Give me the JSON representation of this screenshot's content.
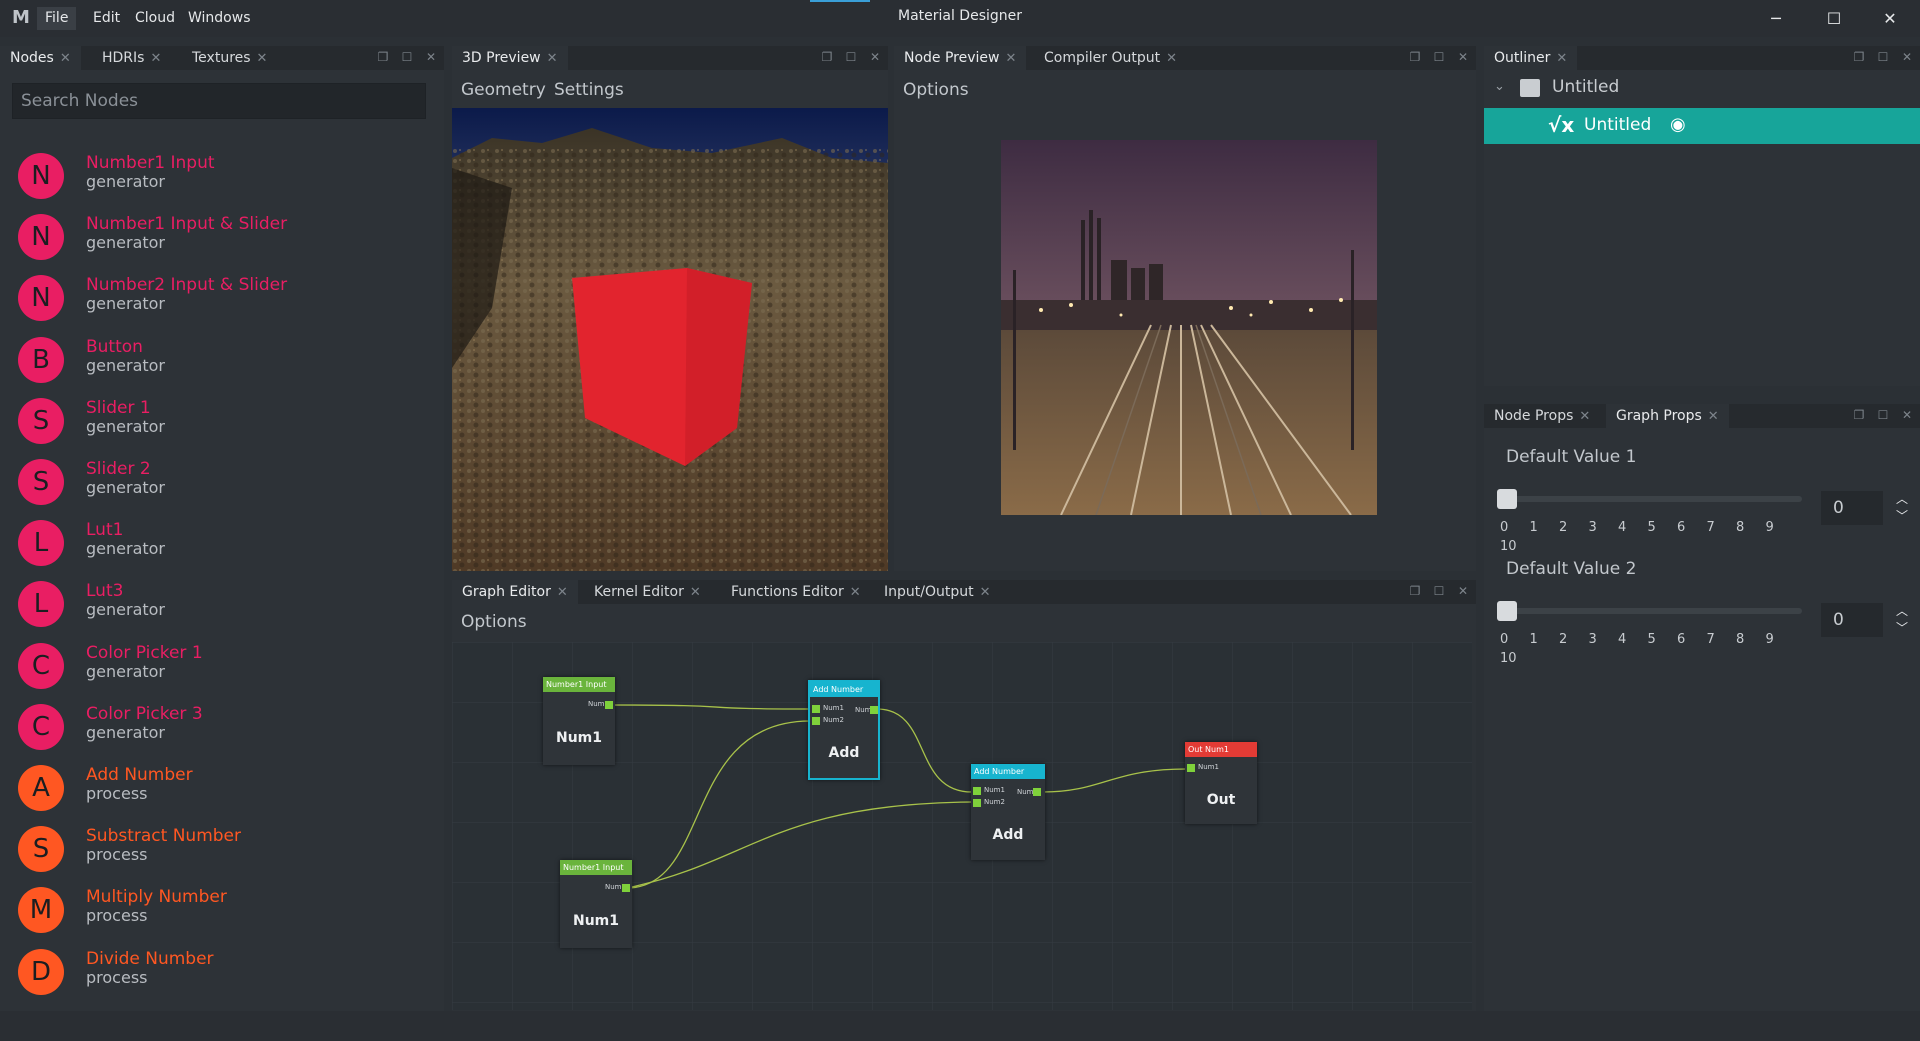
{
  "app": {
    "title": "Material Designer",
    "logo": "M"
  },
  "menu": [
    "File",
    "Edit",
    "Cloud",
    "Windows"
  ],
  "window_controls": {
    "minimize": "─",
    "maximize": "☐",
    "close": "✕"
  },
  "left_panel": {
    "tabs": [
      "Nodes",
      "HDRIs",
      "Textures"
    ],
    "search_placeholder": "Search Nodes",
    "nodes": [
      {
        "letter": "N",
        "title": "Number1 Input",
        "category": "generator",
        "color": "#e91e63"
      },
      {
        "letter": "N",
        "title": "Number1 Input & Slider",
        "category": "generator",
        "color": "#e91e63"
      },
      {
        "letter": "N",
        "title": "Number2 Input & Slider",
        "category": "generator",
        "color": "#e91e63"
      },
      {
        "letter": "B",
        "title": "Button",
        "category": "generator",
        "color": "#e91e63"
      },
      {
        "letter": "S",
        "title": "Slider 1",
        "category": "generator",
        "color": "#e91e63"
      },
      {
        "letter": "S",
        "title": "Slider 2",
        "category": "generator",
        "color": "#e91e63"
      },
      {
        "letter": "L",
        "title": "Lut1",
        "category": "generator",
        "color": "#e91e63"
      },
      {
        "letter": "L",
        "title": "Lut3",
        "category": "generator",
        "color": "#e91e63"
      },
      {
        "letter": "C",
        "title": "Color Picker 1",
        "category": "generator",
        "color": "#e91e63"
      },
      {
        "letter": "C",
        "title": "Color Picker 3",
        "category": "generator",
        "color": "#e91e63"
      },
      {
        "letter": "A",
        "title": "Add Number",
        "category": "process",
        "color": "#ff5722"
      },
      {
        "letter": "S",
        "title": "Substract Number",
        "category": "process",
        "color": "#ff5722"
      },
      {
        "letter": "M",
        "title": "Multiply Number",
        "category": "process",
        "color": "#ff5722"
      },
      {
        "letter": "D",
        "title": "Divide Number",
        "category": "process",
        "color": "#ff5722"
      }
    ]
  },
  "preview3d": {
    "tab": "3D Preview",
    "toolbar": [
      "Geometry",
      "Settings"
    ]
  },
  "node_preview": {
    "tabs": [
      "Node Preview",
      "Compiler Output"
    ],
    "toolbar": "Options"
  },
  "graph_editor": {
    "tabs": [
      "Graph Editor",
      "Kernel Editor",
      "Functions Editor",
      "Input/Output"
    ],
    "toolbar": "Options",
    "nodes": {
      "n1": {
        "header": "Number1 Input",
        "port": "Num1",
        "label": "Num1"
      },
      "n2": {
        "header": "Number1 Input",
        "port": "Num1",
        "label": "Num1"
      },
      "add1": {
        "header": "Add Number",
        "in1": "Num1",
        "in2": "Num2",
        "out": "Num",
        "label": "Add"
      },
      "add2": {
        "header": "Add Number",
        "in1": "Num1",
        "in2": "Num2",
        "out": "Num",
        "label": "Add"
      },
      "out": {
        "header": "Out Num1",
        "in1": "Num1",
        "label": "Out"
      }
    }
  },
  "outliner": {
    "tab": "Outliner",
    "root": "Untitled",
    "item": "Untitled"
  },
  "props": {
    "tabs": [
      "Node Props",
      "Graph Props"
    ],
    "values": [
      {
        "label": "Default Value 1",
        "value": "0",
        "ticks": [
          "0",
          "1",
          "2",
          "3",
          "4",
          "5",
          "6",
          "7",
          "8",
          "9",
          "10"
        ],
        "slider": 0
      },
      {
        "label": "Default Value 2",
        "value": "0",
        "ticks": [
          "0",
          "1",
          "2",
          "3",
          "4",
          "5",
          "6",
          "7",
          "8",
          "9",
          "10"
        ],
        "slider": 0
      }
    ]
  },
  "colors": {
    "accent": "#17a59a",
    "generator": "#e91e63",
    "process": "#ff5722"
  }
}
